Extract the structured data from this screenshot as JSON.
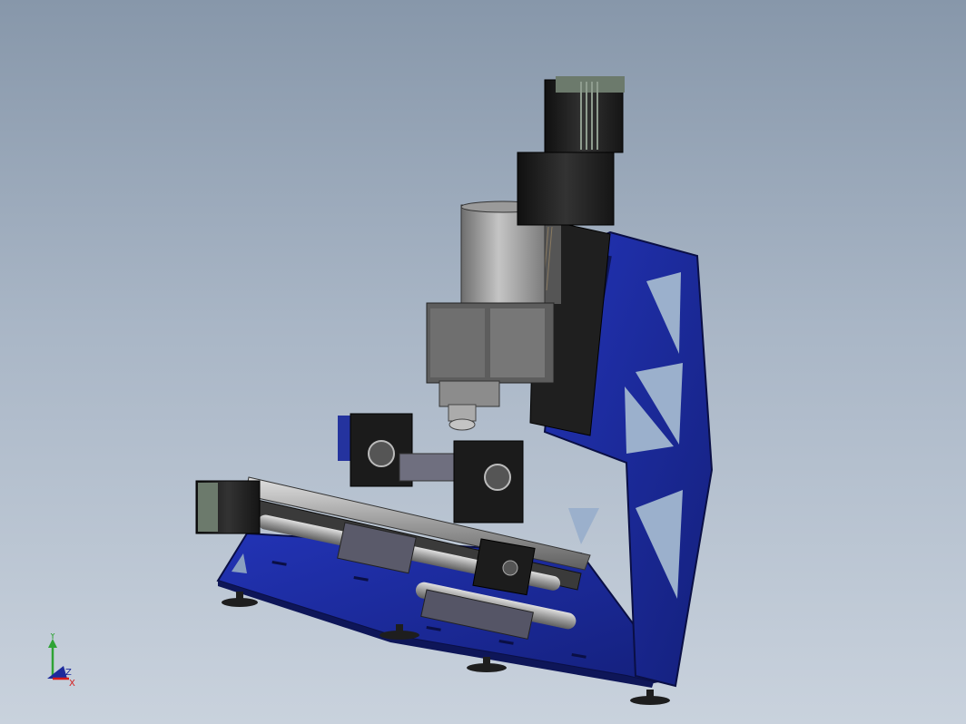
{
  "viewport": {
    "background_top": "#8797aa",
    "background_bottom": "#c9d2dd"
  },
  "model": {
    "frame_color": "#1d2a9c",
    "frame_edge_color": "#0a0f45",
    "motor_color": "#1b1b1b",
    "spindle_color": "#8e8e8e",
    "rail_color": "#b7b7b7",
    "carriage_color": "#262626"
  },
  "triad": {
    "y_label": "Y",
    "z_label": "Z",
    "x_label": "X",
    "y_color": "#2fa335",
    "z_color": "#1d2a9c",
    "x_color": "#d61b1b"
  }
}
